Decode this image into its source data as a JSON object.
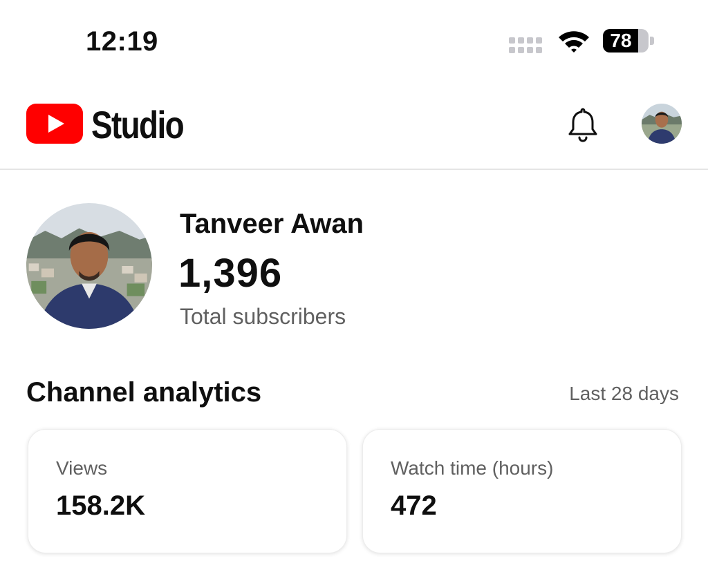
{
  "status_bar": {
    "time": "12:19",
    "battery_level": "78",
    "battery_fraction": 0.78
  },
  "header": {
    "app_name": "Studio",
    "brand_color": "#ff0000",
    "icons": [
      "youtube-logo-icon",
      "notification-bell-icon",
      "account-avatar"
    ]
  },
  "channel": {
    "name": "Tanveer Awan",
    "subscriber_count": "1,396",
    "subscriber_label": "Total subscribers"
  },
  "analytics": {
    "title": "Channel analytics",
    "period": "Last 28 days",
    "cards": [
      {
        "label": "Views",
        "value": "158.2K"
      },
      {
        "label": "Watch time (hours)",
        "value": "472"
      }
    ]
  }
}
